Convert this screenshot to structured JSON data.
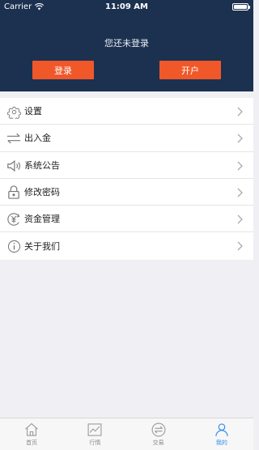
{
  "status_bar": {
    "carrier": "Carrier",
    "time": "11:09 AM"
  },
  "header": {
    "login_status": "您还未登录",
    "login_button": "登录",
    "open_account_button": "开户"
  },
  "menu": {
    "items": [
      {
        "label": "设置",
        "icon": "gear-icon"
      },
      {
        "label": "出入金",
        "icon": "transfer-arrows-icon"
      },
      {
        "label": "系统公告",
        "icon": "speaker-icon"
      },
      {
        "label": "修改密码",
        "icon": "lock-icon"
      },
      {
        "label": "资金管理",
        "icon": "yuan-coin-icon"
      },
      {
        "label": "关于我们",
        "icon": "info-icon"
      }
    ]
  },
  "tab_bar": {
    "tabs": [
      {
        "label": "首页",
        "icon": "home-icon",
        "active": false
      },
      {
        "label": "行情",
        "icon": "chart-icon",
        "active": false
      },
      {
        "label": "交易",
        "icon": "exchange-icon",
        "active": false
      },
      {
        "label": "我的",
        "icon": "user-icon",
        "active": true
      }
    ]
  },
  "colors": {
    "header_bg": "#1c3150",
    "button_bg": "#f0582a",
    "active_tab": "#2d8cf0"
  }
}
